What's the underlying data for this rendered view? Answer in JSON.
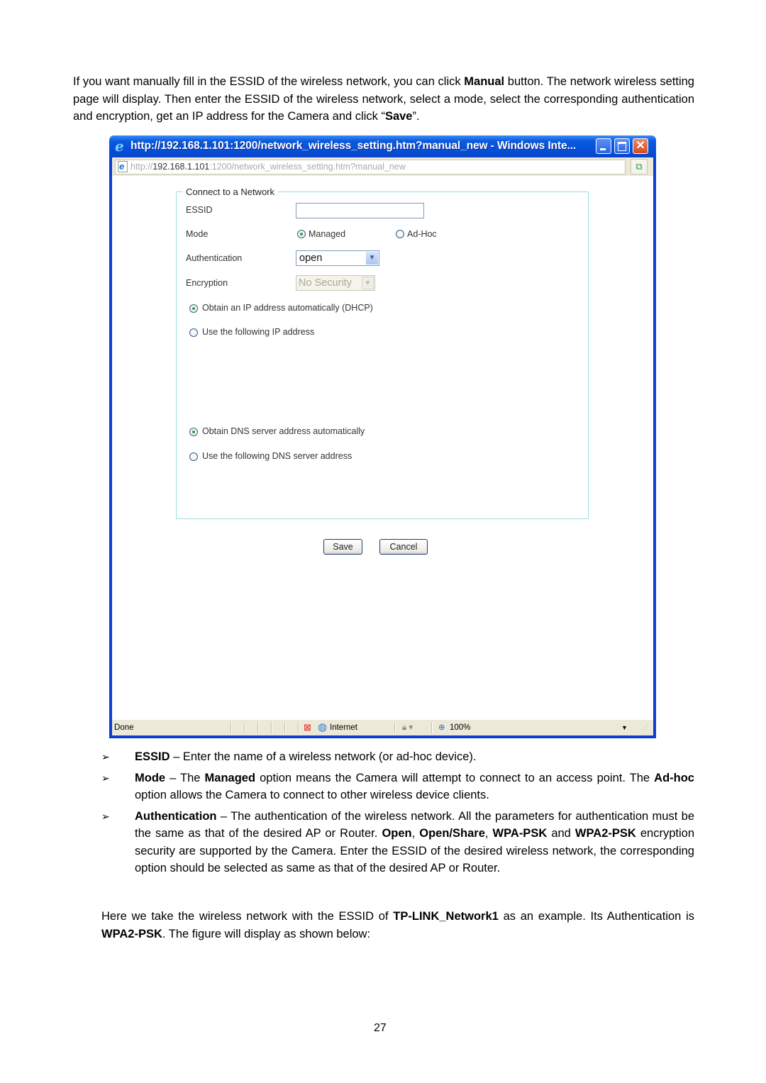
{
  "intro": {
    "p1": "If you want manually fill in the ESSID of the wireless network, you can click ",
    "b1": "Manual",
    "p2": " button. The network wireless setting page will display. Then enter the ESSID of the wireless network, select a mode, select the corresponding authentication and encryption, get an IP address for the Camera and click “",
    "b2": "Save",
    "p3": "”."
  },
  "browser": {
    "title": "http://192.168.1.101:1200/network_wireless_setting.htm?manual_new - Windows Inte...",
    "address_scheme": "http://",
    "address_host": "192.168.1.101",
    "address_rest": ":1200/network_wireless_setting.htm?manual_new",
    "status_text": "Done",
    "zone": "Internet",
    "zoom": "100%"
  },
  "form": {
    "legend": "Connect to a Network",
    "essid_label": "ESSID",
    "essid_value": "",
    "mode_label": "Mode",
    "mode_options": [
      {
        "label": "Managed",
        "checked": true
      },
      {
        "label": "Ad-Hoc",
        "checked": false
      }
    ],
    "auth_label": "Authentication",
    "auth_value": "open",
    "enc_label": "Encryption",
    "enc_value": "No Security",
    "ip_options": [
      {
        "label": "Obtain an IP address automatically (DHCP)",
        "checked": true
      },
      {
        "label": "Use the following IP address",
        "checked": false
      }
    ],
    "dns_options": [
      {
        "label": "Obtain DNS server address automatically",
        "checked": true
      },
      {
        "label": "Use the following DNS server address",
        "checked": false
      }
    ],
    "save_label": "Save",
    "cancel_label": "Cancel"
  },
  "bullets": [
    {
      "term": "ESSID",
      "text": " – Enter the name of a wireless network (or ad-hoc device)."
    },
    {
      "term": "Mode",
      "t1": " – The ",
      "b1": "Managed",
      "t2": " option means the Camera will attempt to connect to an access point. The ",
      "b2": "Ad-hoc",
      "t3": " option allows the Camera to connect to other wireless device clients."
    },
    {
      "term": "Authentication",
      "t1": " – The authentication of the wireless network. All the parameters for authentication must be the same as that of the desired AP or Router. ",
      "b1": "Open",
      "t2": ", ",
      "b2": "Open/Share",
      "t3": ", ",
      "b3": "WPA-PSK",
      "t4": " and ",
      "b4": "WPA2-PSK",
      "t5": " encryption security are supported by the Camera. Enter the ESSID of the desired wireless network, the corresponding option should be selected as same as that of the desired AP or Router."
    }
  ],
  "outro": {
    "t1": "Here we take the wireless network with the ESSID of ",
    "b1": "TP-LINK_Network1",
    "t2": " as an example. Its Authentication is ",
    "b2": "WPA2-PSK",
    "t3": ". The figure will display as shown below:"
  },
  "page_number": "27"
}
